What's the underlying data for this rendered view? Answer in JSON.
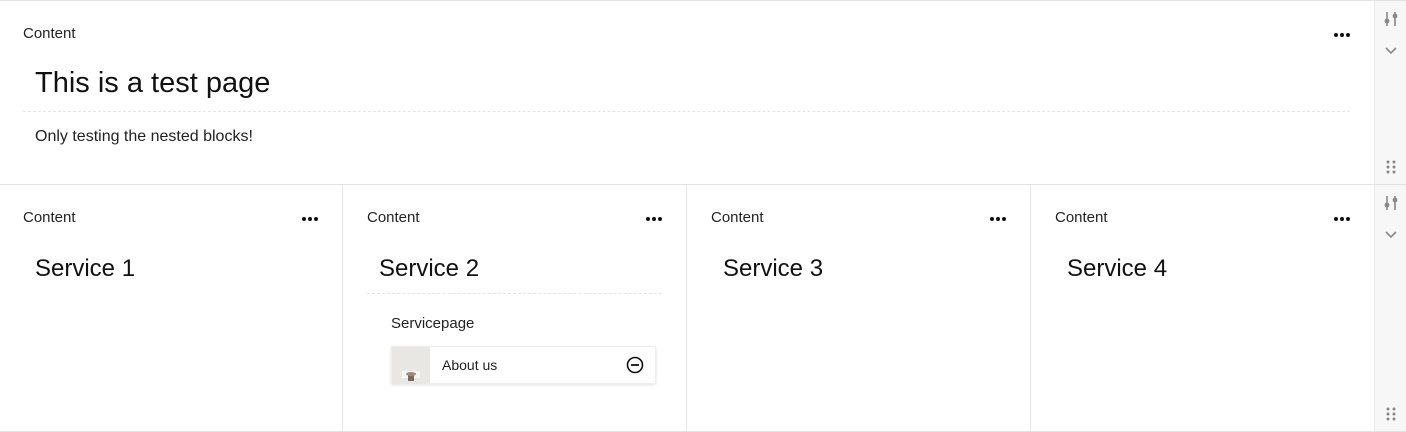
{
  "top_block": {
    "label": "Content",
    "title": "This is a test page",
    "body": "Only testing the nested blocks!"
  },
  "columns": [
    {
      "label": "Content",
      "title": "Service 1"
    },
    {
      "label": "Content",
      "title": "Service 2",
      "subheading": "Servicepage",
      "link": {
        "text": "About us"
      }
    },
    {
      "label": "Content",
      "title": "Service 3"
    },
    {
      "label": "Content",
      "title": "Service 4"
    }
  ],
  "icons": {
    "settings": "settings-sliders-icon",
    "collapse": "chevron-down-icon",
    "drag": "drag-handle-icon",
    "more": "more-dots-icon",
    "remove": "remove-circle-icon"
  }
}
